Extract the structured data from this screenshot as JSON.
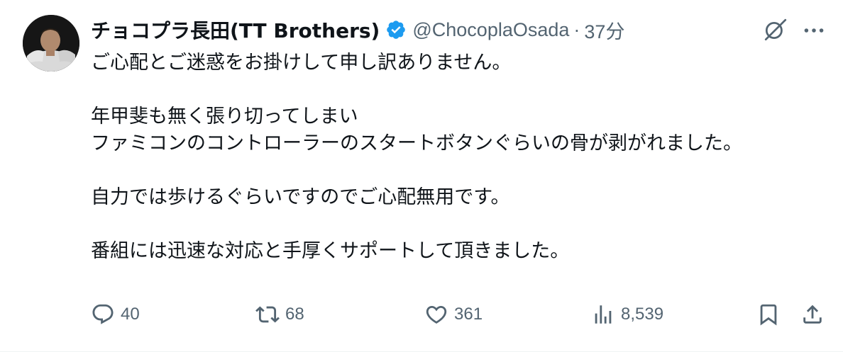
{
  "tweet": {
    "author": {
      "display_name": "チョコプラ長田(TT Brothers)",
      "handle": "@ChocoplaOsada",
      "verified": true
    },
    "separator": "·",
    "time": "37分",
    "body": {
      "line1": "ご心配とご迷惑をお掛けして申し訳ありません。",
      "line2": "年甲斐も無く張り切ってしまい",
      "line3": "ファミコンのコントローラーのスタートボタンぐらいの骨が剥がれました。",
      "line4": "自力では歩けるぐらいですのでご心配無用です。",
      "line5": "番組には迅速な対応と手厚くサポートして頂きました。"
    },
    "actions": {
      "reply_count": "40",
      "retweet_count": "68",
      "like_count": "361",
      "view_count": "8,539"
    }
  },
  "icons": {
    "verified": "verified-badge-icon",
    "grok": "grok-icon",
    "more": "more-icon",
    "reply": "reply-icon",
    "retweet": "retweet-icon",
    "like": "heart-icon",
    "views": "views-icon",
    "bookmark": "bookmark-icon",
    "share": "share-icon"
  },
  "colors": {
    "text": "#0f1419",
    "secondary": "#536471",
    "verified_blue": "#1d9bf0"
  }
}
